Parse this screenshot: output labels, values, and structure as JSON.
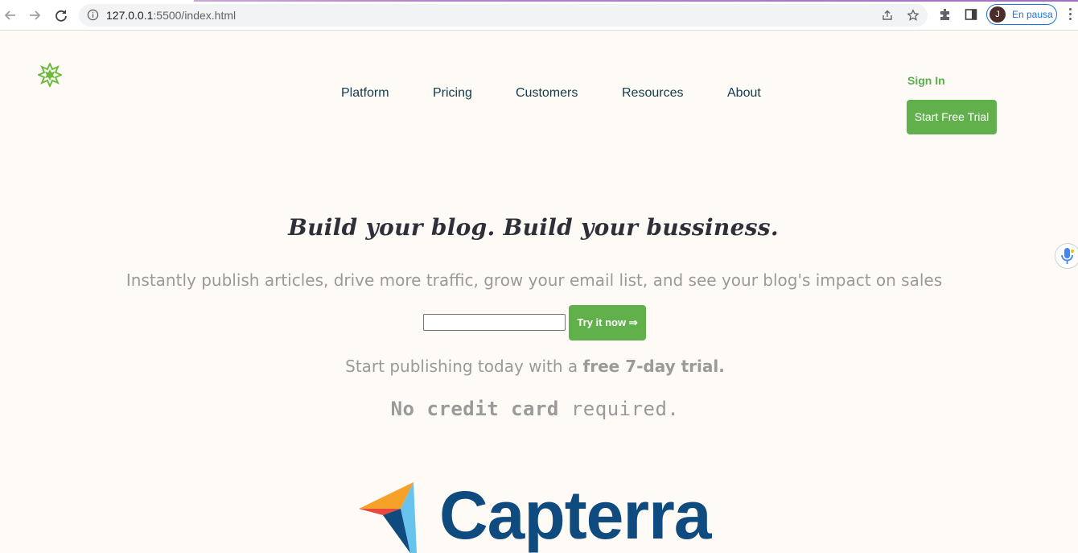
{
  "browser": {
    "url_host": "127.0.0.1",
    "url_path": ":5500/index.html",
    "profile_initial": "J",
    "profile_label": "En pausa",
    "icons": [
      "back-arrow-icon",
      "forward-arrow-icon",
      "reload-icon",
      "info-icon",
      "share-icon",
      "star-icon",
      "extensions-icon",
      "side-panel-icon",
      "menu-icon"
    ]
  },
  "header": {
    "logo_icon": "star-burst-logo-icon",
    "nav": [
      {
        "label": "Platform"
      },
      {
        "label": "Pricing"
      },
      {
        "label": "Customers"
      },
      {
        "label": "Resources"
      },
      {
        "label": "About"
      }
    ],
    "sign_in": "Sign In",
    "cta": "Start Free Trial"
  },
  "hero": {
    "title": "Build your blog. Build your bussiness.",
    "subtitle": "Instantly publish articles, drive more traffic, grow your email list, and see your blog's impact on sales",
    "email_value": "",
    "try_button": "Try it now ⇒",
    "start_prefix": "Start publishing today with a ",
    "start_bold": "free 7-day trial.",
    "nocard_bold": "No credit card",
    "nocard_rest": " required."
  },
  "brand": {
    "capterra": "Capterra",
    "colors": {
      "accent_green": "#62b04b",
      "nav_text": "#133a4e",
      "capterra_blue": "#0f4b7f"
    }
  }
}
